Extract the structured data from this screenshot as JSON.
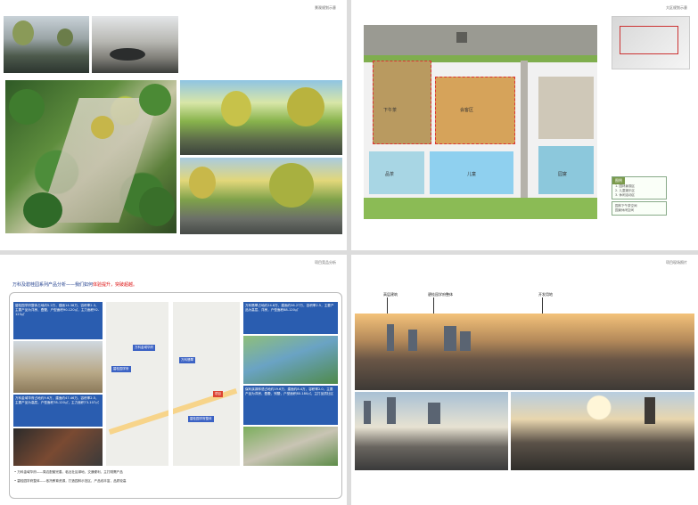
{
  "pages": {
    "p1": {
      "header": "景观规划示意"
    },
    "p2": {
      "header": "大区规划示意",
      "plan_labels": {
        "tea": "下午茶",
        "meeting": "会客区",
        "pool": "品茶",
        "kids": "儿童",
        "game": "园宴"
      },
      "legend": {
        "title": "图例",
        "lines": [
          "1. 园林景观区",
          "2. 儿童娱乐区",
          "3. 休闲活动区"
        ]
      },
      "legend2": [
        "园林下午茶空间",
        "园景休闲空间"
      ]
    },
    "p3": {
      "header": "项目竞品分析",
      "title_blue": "万科及碧桂园系列产品分析——我们如何",
      "title_red": "体验提升，突破超越。",
      "box_left_top": "碧桂园学府整体占地约5.2万，建面14.38万，容积率2.3，主要产品为洋房、叠墅，户型面积90-120㎡，主力面积92-123㎡",
      "box_left_mid": "万科金域华府占地约9.6万，建面约47.46万，容积率2.5，主要产品为高层，户型面积78-120㎡，主力面积73-107㎡",
      "box_right_top": "万科翡翠占地约24.8万，建面约56.27万，容积率2.5，主要产品为高层、洋房，户型面积88-120㎡",
      "box_right_mid": "保利溪湖林语占地约19.6万，建面约8.4万，容积率2.0，主要产品为洋房、叠墅、别墅，户型面积80-180㎡，主打品质社区",
      "map_labels": [
        "万科金域华府",
        "碧桂园学府",
        "万科翡翠",
        "项目",
        "碧桂园学府整体"
      ],
      "notes": [
        "• 万科金域华府——周边配套完善，临近社区绿地，交通便利，主打刚需产品",
        "• 碧桂园学府整体——依托教育资源，打造园林示范区，产品线丰富，品质较高"
      ]
    },
    "p4": {
      "header": "项目现场照片",
      "callouts": [
        "高层建筑",
        "碧桂园学府整体",
        "开发用地"
      ]
    }
  }
}
